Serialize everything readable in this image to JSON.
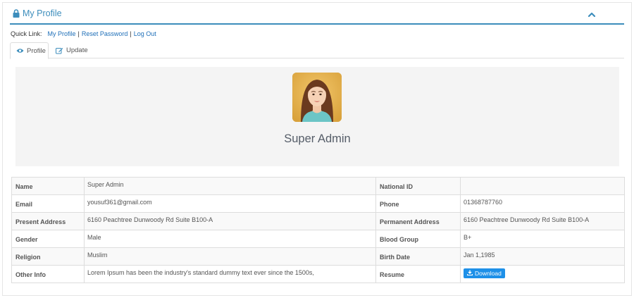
{
  "panel": {
    "title": "My Profile",
    "icon": "lock-icon",
    "collapse_icon": "chevron-up-icon",
    "accent": "#3c8dbc"
  },
  "quick_links": {
    "label": "Quick Link:",
    "links": [
      "My Profile",
      "Reset Password",
      "Log Out"
    ],
    "separator": "|"
  },
  "tabs": [
    {
      "label": "Profile",
      "icon": "eye-icon",
      "active": true
    },
    {
      "label": "Update",
      "icon": "edit-icon",
      "active": false
    }
  ],
  "profile": {
    "name": "Super Admin",
    "avatar": "woman-avatar"
  },
  "details": {
    "rows": [
      {
        "k1": "Name",
        "v1": "Super Admin",
        "k2": "National ID",
        "v2": ""
      },
      {
        "k1": "Email",
        "v1": "yousuf361@gmail.com",
        "k2": "Phone",
        "v2": "01368787760"
      },
      {
        "k1": "Present Address",
        "v1": "6160 Peachtree Dunwoody Rd Suite B100-A",
        "k2": "Permanent Address",
        "v2": "6160 Peachtree Dunwoody Rd Suite B100-A"
      },
      {
        "k1": "Gender",
        "v1": "Male",
        "k2": "Blood Group",
        "v2": "B+"
      },
      {
        "k1": "Religion",
        "v1": "Muslim",
        "k2": "Birth Date",
        "v2": "Jan 1,1985"
      },
      {
        "k1": "Other Info",
        "v1": "Lorem Ipsum has been the industry's standard dummy text ever since the 1500s,",
        "k2": "Resume",
        "v2": ""
      }
    ],
    "download_label": "Download",
    "download_color": "#1e90e8"
  }
}
